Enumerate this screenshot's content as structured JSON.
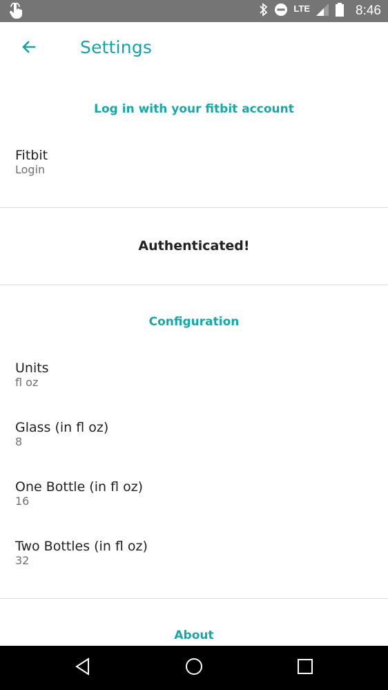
{
  "status_bar": {
    "network": "LTE",
    "time": "8:46",
    "icons": [
      "touch-hand-icon",
      "bluetooth-icon",
      "do-not-disturb-icon",
      "signal-icon",
      "battery-icon"
    ]
  },
  "app_bar": {
    "title": "Settings",
    "back_icon": "arrow-back-icon"
  },
  "sections": {
    "login_header": "Log in with your fitbit account",
    "fitbit": {
      "label": "Fitbit",
      "sub": "Login"
    },
    "auth_status": "Authenticated!",
    "config_header": "Configuration",
    "units": {
      "label": "Units",
      "sub": "fl oz"
    },
    "glass": {
      "label": "Glass (in fl oz)",
      "sub": "8"
    },
    "one_bottle": {
      "label": "One Bottle (in fl oz)",
      "sub": "16"
    },
    "two_bottles": {
      "label": "Two Bottles (in fl oz)",
      "sub": "32"
    },
    "about_header": "About"
  },
  "nav_bar": {
    "icons": [
      "back-triangle-icon",
      "home-circle-icon",
      "recents-square-icon"
    ]
  },
  "colors": {
    "accent": "#17a7ab",
    "status_bar": "#757575",
    "nav_bar": "#000000",
    "divider": "#dcdcdc"
  }
}
